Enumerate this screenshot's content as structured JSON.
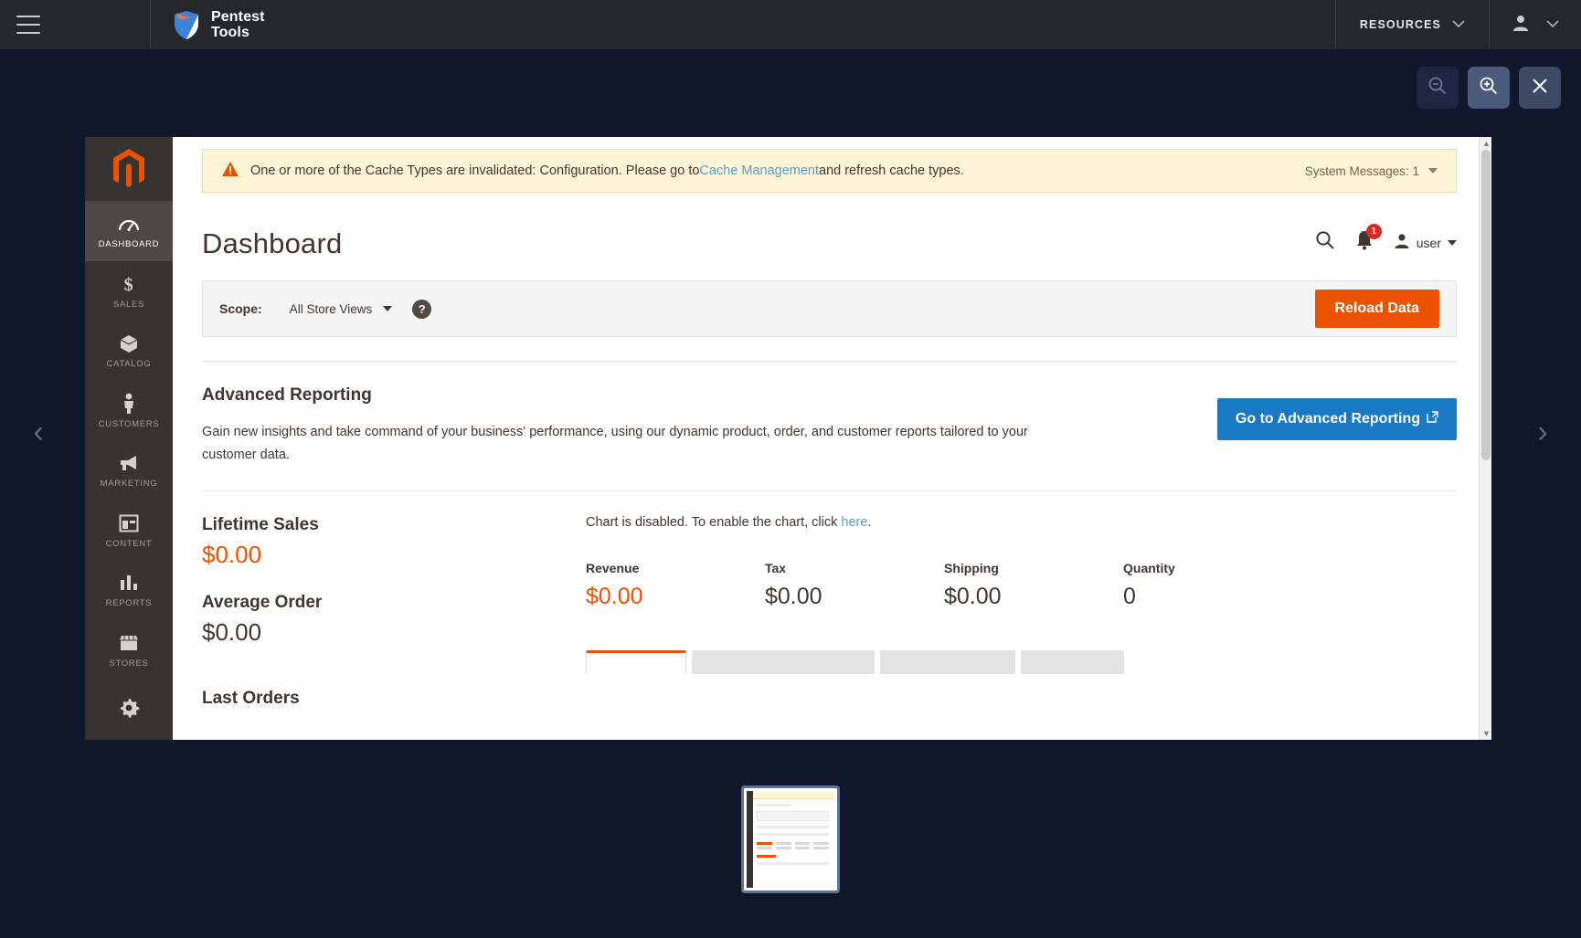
{
  "appbar": {
    "menu_icon": "hamburger-icon",
    "brand_line1": "Pentest",
    "brand_line2": "Tools",
    "resources_label": "RESOURCES",
    "user_icon": "user-avatar-icon"
  },
  "viewer_toolbar": {
    "zoom_out": "zoom-out-icon",
    "zoom_in": "zoom-in-icon",
    "close": "close-icon"
  },
  "navigation": {
    "prev": "‹",
    "next": "›"
  },
  "screenshot": {
    "sidebar": {
      "logo": "magento-logo-icon",
      "items": [
        {
          "label": "DASHBOARD",
          "icon": "gauge-icon",
          "active": true
        },
        {
          "label": "SALES",
          "icon": "dollar-icon",
          "active": false
        },
        {
          "label": "CATALOG",
          "icon": "box-icon",
          "active": false
        },
        {
          "label": "CUSTOMERS",
          "icon": "person-icon",
          "active": false
        },
        {
          "label": "MARKETING",
          "icon": "megaphone-icon",
          "active": false
        },
        {
          "label": "CONTENT",
          "icon": "layout-icon",
          "active": false
        },
        {
          "label": "REPORTS",
          "icon": "bar-chart-icon",
          "active": false
        },
        {
          "label": "STORES",
          "icon": "storefront-icon",
          "active": false
        },
        {
          "label": "",
          "icon": "gear-icon",
          "active": false
        }
      ]
    },
    "banner": {
      "icon": "warning-triangle-icon",
      "text_before": "One or more of the Cache Types are invalidated: Configuration. Please go to ",
      "link": "Cache Management",
      "text_after": " and refresh cache types.",
      "system_messages": "System Messages: 1"
    },
    "header": {
      "title": "Dashboard",
      "search_icon": "search-icon",
      "bell_icon": "bell-icon",
      "bell_count": "1",
      "user_name": "user"
    },
    "scope": {
      "label": "Scope:",
      "value": "All Store Views",
      "help": "?",
      "reload_label": "Reload Data"
    },
    "advanced_reporting": {
      "heading": "Advanced Reporting",
      "body": "Gain new insights and take command of your business' performance, using our dynamic product, order, and customer reports tailored to your customer data.",
      "button_label": "Go to Advanced Reporting",
      "button_icon": "external-link-icon"
    },
    "stats": [
      {
        "label": "Lifetime Sales",
        "value": "$0.00",
        "accent": true
      },
      {
        "label": "Average Order",
        "value": "$0.00",
        "accent": false
      }
    ],
    "last_orders_label": "Last Orders",
    "chart": {
      "disabled_before": "Chart is disabled. To enable the chart, click ",
      "disabled_link": "here",
      "disabled_after": "."
    },
    "metrics": [
      {
        "label": "Revenue",
        "value": "$0.00",
        "accent": true
      },
      {
        "label": "Tax",
        "value": "$0.00",
        "accent": false
      },
      {
        "label": "Shipping",
        "value": "$0.00",
        "accent": false
      },
      {
        "label": "Quantity",
        "value": "0",
        "accent": false
      }
    ]
  },
  "colors": {
    "magento_orange": "#eb5202",
    "link_blue": "#5a9ccf",
    "button_blue": "#1979c3",
    "banner_yellow": "#fdf6d6",
    "badge_red": "#e22626",
    "app_dark": "#25272b",
    "page_navy": "#10172b"
  }
}
